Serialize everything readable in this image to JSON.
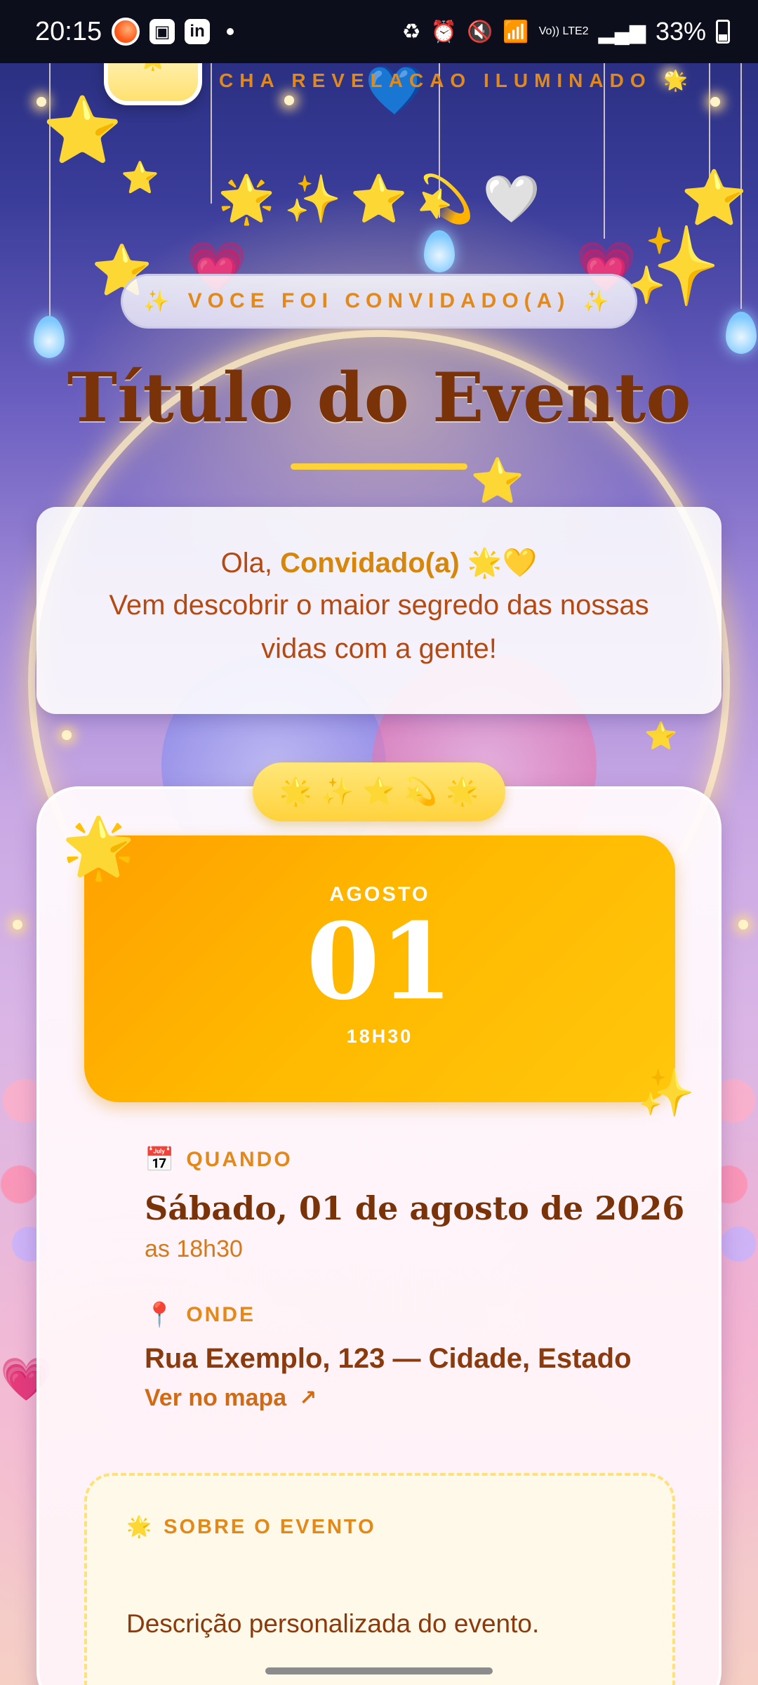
{
  "status_bar": {
    "time": "20:15",
    "battery": "33%",
    "network_label": "Vo)) LTE2",
    "icons": [
      "instagram-style-icon",
      "gallery-icon",
      "linkedin-icon",
      "battery-saver-icon",
      "alarm-icon",
      "mute-icon",
      "wifi-icon",
      "signal-icon"
    ]
  },
  "header": {
    "logo_icon": "star-icon",
    "eyebrow": "CHA REVELACAO ILUMINADO",
    "eyebrow_emoji": "🌟",
    "emoji_row": [
      "🌟",
      "✨",
      "⭐",
      "💫",
      "🤍"
    ]
  },
  "invite": {
    "label": "VOCE FOI CONVIDADO(A)",
    "left_emoji": "✨",
    "right_emoji": "✨"
  },
  "event": {
    "title": "Título do Evento"
  },
  "greeting": {
    "prefix": "Ola, ",
    "name": "Convidado(a)",
    "emoji": "🌟💛",
    "message": "Vem descobrir o maior segredo das nossas vidas com a gente!"
  },
  "card": {
    "emoji_pill": [
      "🌟",
      "✨",
      "⭐",
      "💫",
      "🌟"
    ],
    "corner_top_left": "🌟",
    "corner_bottom_right": "✨",
    "date": {
      "month": "AGOSTO",
      "day": "01",
      "time": "18H30"
    },
    "when": {
      "icon": "📅",
      "label": "QUANDO",
      "date_long": "Sábado, 01 de agosto de 2026",
      "time_long": "as 18h30"
    },
    "where": {
      "icon": "📍",
      "label": "ONDE",
      "address": "Rua Exemplo, 123 — Cidade, Estado",
      "map_link": "Ver no mapa",
      "map_arrow": "↗"
    },
    "about": {
      "icon": "🌟",
      "label": "SOBRE O EVENTO",
      "text": "Descrição personalizada do evento."
    }
  },
  "colors": {
    "title_brown": "#7a3208",
    "accent_orange": "#e2891a",
    "date_gold": "#ffb800",
    "underline_yellow": "#ffd23a"
  }
}
